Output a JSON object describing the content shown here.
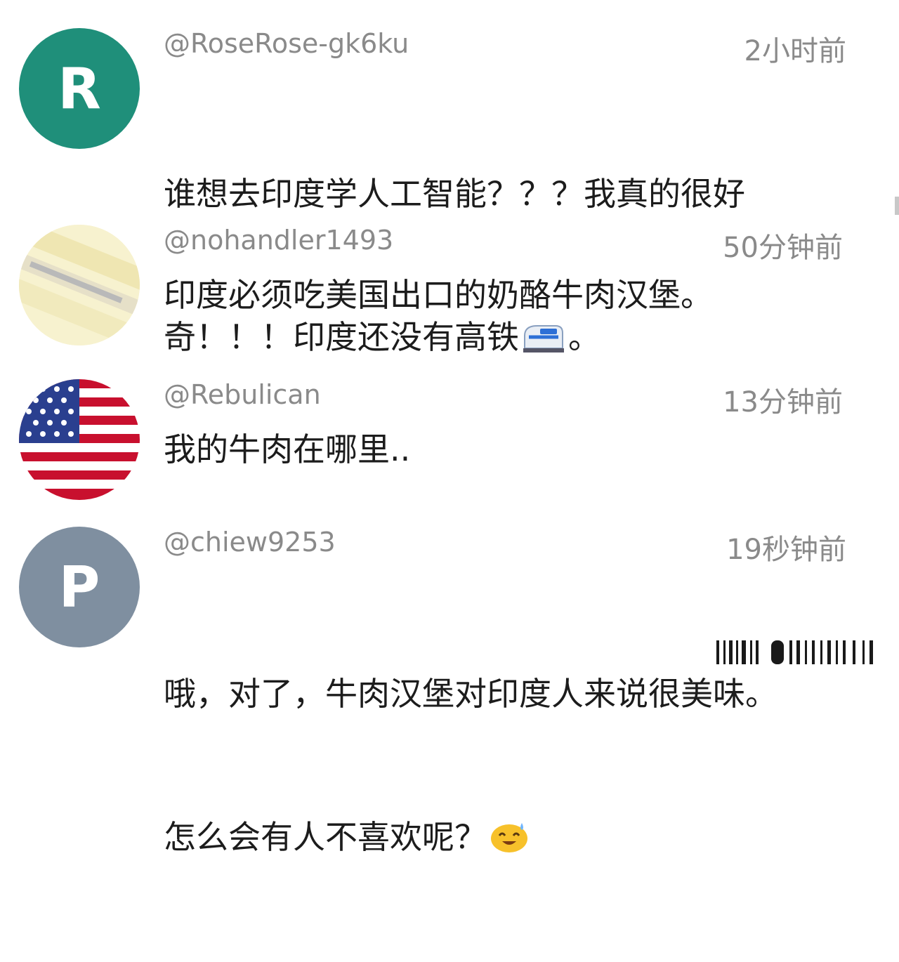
{
  "comments": [
    {
      "handle": "@RoseRose-gk6ku",
      "time": "2小时前",
      "avatar": {
        "letter": "R",
        "color": "#1f8f7a"
      },
      "lines": [
        "谁想去印度学人工智能？？？我真的很好",
        "奇！！！印度还没有高铁"
      ],
      "line2_tail": "。",
      "emoji": "bullet-train-icon"
    },
    {
      "handle": "@nohandler1493",
      "time": "50分钟前",
      "avatar": {
        "letter": "",
        "color": "#f6f0c8"
      },
      "text": "印度必须吃美国出口的奶酪牛肉汉堡。"
    },
    {
      "handle": "@Rebulican",
      "time": "13分钟前",
      "avatar": {
        "letter": "",
        "color": "#b22234"
      },
      "text": "我的牛肉在哪里.."
    },
    {
      "handle": "@chiew9253",
      "time": "19秒钟前",
      "avatar": {
        "letter": "P",
        "color": "#7f8fa0"
      },
      "lines": [
        "哦，对了，牛肉汉堡对印度人来说很美味。",
        "怎么会有人不喜欢呢？"
      ],
      "emoji": "sweat-smile-icon"
    }
  ]
}
